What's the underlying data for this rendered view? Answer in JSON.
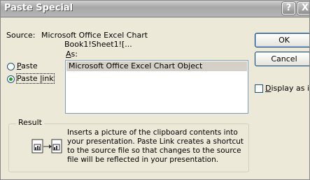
{
  "window": {
    "title": "Paste Special",
    "help_glyph": "?",
    "close_glyph": "X"
  },
  "source": {
    "label": "Source:",
    "line1": "Microsoft Office Excel Chart",
    "line2": "Book1!Sheet1![..."
  },
  "as_label": "As:",
  "options": {
    "paste": {
      "label": "Paste",
      "selected": false
    },
    "paste_link": {
      "label": "Paste link",
      "selected": true
    }
  },
  "list": {
    "items": [
      "Microsoft Office Excel Chart Object"
    ]
  },
  "buttons": {
    "ok": "OK",
    "cancel": "Cancel"
  },
  "display_as_icon": {
    "label": "Display as icon",
    "checked": false
  },
  "result": {
    "label": "Result",
    "description": "Inserts a picture of the clipboard contents into your presentation. Paste Link creates a shortcut to the source file so that changes to the source file will be reflected in your presentation."
  },
  "icons": [
    "paste-link-result-icon"
  ]
}
